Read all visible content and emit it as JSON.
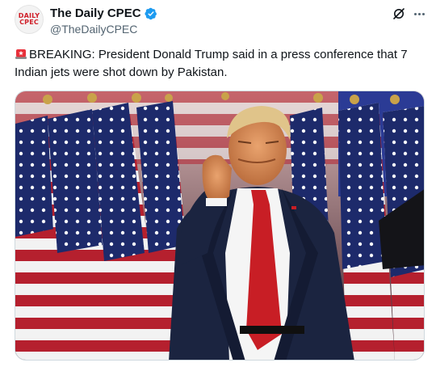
{
  "account": {
    "avatar_line1": "DAILY",
    "avatar_line2": "CPEC",
    "display_name": "The Daily CPEC",
    "handle": "@TheDailyCPEC",
    "verified_icon": "verified-badge-icon"
  },
  "tweet": {
    "text": "BREAKING: President Donald Trump said in a press conference that 7 Indian jets were shot down by Pakistan.",
    "leading_emoji": "rotating-light-icon"
  },
  "icons": {
    "grok": "grok-icon",
    "more": "more-options-icon"
  },
  "media": {
    "description_icon": "photo",
    "colors": {
      "flag_red": "#b5202e",
      "flag_blue": "#1d2a6b",
      "suit": "#1b2440",
      "tie": "#c81e25"
    }
  },
  "colors": {
    "verified_blue": "#1d9bf0",
    "text": "#0f1419",
    "muted": "#536471"
  }
}
